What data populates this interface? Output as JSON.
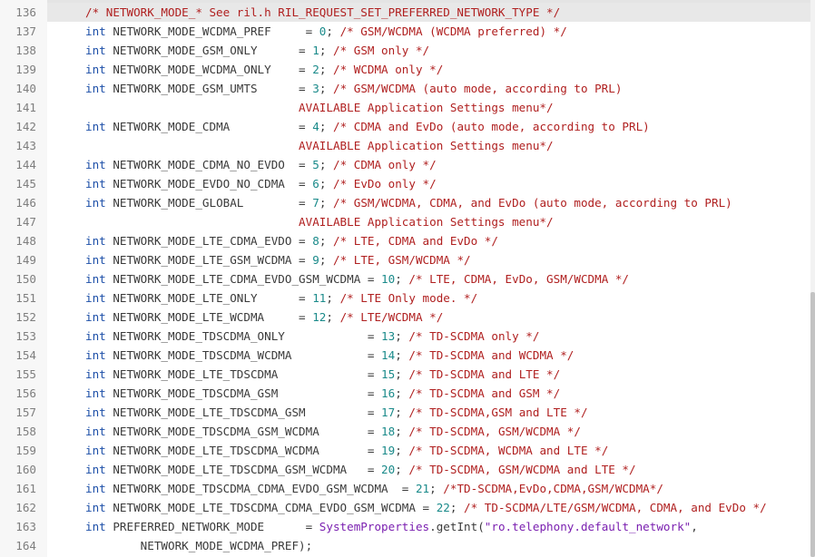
{
  "editor": {
    "lines": [
      {
        "n": "136",
        "current": true,
        "tokens": [
          {
            "t": "/* NETWORK_MODE_* See ril.h RIL_REQUEST_SET_PREFERRED_NETWORK_TYPE */",
            "c": "cm"
          }
        ]
      },
      {
        "n": "137",
        "tokens": [
          {
            "t": "int",
            "c": "kw"
          },
          {
            "t": " NETWORK_MODE_WCDMA_PREF     = ",
            "c": "plain"
          },
          {
            "t": "0",
            "c": "num"
          },
          {
            "t": "; ",
            "c": "plain"
          },
          {
            "t": "/* GSM/WCDMA (WCDMA preferred) */",
            "c": "cm"
          }
        ]
      },
      {
        "n": "138",
        "tokens": [
          {
            "t": "int",
            "c": "kw"
          },
          {
            "t": " NETWORK_MODE_GSM_ONLY      = ",
            "c": "plain"
          },
          {
            "t": "1",
            "c": "num"
          },
          {
            "t": "; ",
            "c": "plain"
          },
          {
            "t": "/* GSM only */",
            "c": "cm"
          }
        ]
      },
      {
        "n": "139",
        "tokens": [
          {
            "t": "int",
            "c": "kw"
          },
          {
            "t": " NETWORK_MODE_WCDMA_ONLY    = ",
            "c": "plain"
          },
          {
            "t": "2",
            "c": "num"
          },
          {
            "t": "; ",
            "c": "plain"
          },
          {
            "t": "/* WCDMA only */",
            "c": "cm"
          }
        ]
      },
      {
        "n": "140",
        "tokens": [
          {
            "t": "int",
            "c": "kw"
          },
          {
            "t": " NETWORK_MODE_GSM_UMTS      = ",
            "c": "plain"
          },
          {
            "t": "3",
            "c": "num"
          },
          {
            "t": "; ",
            "c": "plain"
          },
          {
            "t": "/* GSM/WCDMA (auto mode, according to PRL)",
            "c": "cm"
          }
        ]
      },
      {
        "n": "141",
        "tokens": [
          {
            "t": "                               ",
            "c": "plain"
          },
          {
            "t": "AVAILABLE Application Settings menu*/",
            "c": "cm"
          }
        ]
      },
      {
        "n": "142",
        "tokens": [
          {
            "t": "int",
            "c": "kw"
          },
          {
            "t": " NETWORK_MODE_CDMA          = ",
            "c": "plain"
          },
          {
            "t": "4",
            "c": "num"
          },
          {
            "t": "; ",
            "c": "plain"
          },
          {
            "t": "/* CDMA and EvDo (auto mode, according to PRL)",
            "c": "cm"
          }
        ]
      },
      {
        "n": "143",
        "tokens": [
          {
            "t": "                               ",
            "c": "plain"
          },
          {
            "t": "AVAILABLE Application Settings menu*/",
            "c": "cm"
          }
        ]
      },
      {
        "n": "144",
        "tokens": [
          {
            "t": "int",
            "c": "kw"
          },
          {
            "t": " NETWORK_MODE_CDMA_NO_EVDO  = ",
            "c": "plain"
          },
          {
            "t": "5",
            "c": "num"
          },
          {
            "t": "; ",
            "c": "plain"
          },
          {
            "t": "/* CDMA only */",
            "c": "cm"
          }
        ]
      },
      {
        "n": "145",
        "tokens": [
          {
            "t": "int",
            "c": "kw"
          },
          {
            "t": " NETWORK_MODE_EVDO_NO_CDMA  = ",
            "c": "plain"
          },
          {
            "t": "6",
            "c": "num"
          },
          {
            "t": "; ",
            "c": "plain"
          },
          {
            "t": "/* EvDo only */",
            "c": "cm"
          }
        ]
      },
      {
        "n": "146",
        "tokens": [
          {
            "t": "int",
            "c": "kw"
          },
          {
            "t": " NETWORK_MODE_GLOBAL        = ",
            "c": "plain"
          },
          {
            "t": "7",
            "c": "num"
          },
          {
            "t": "; ",
            "c": "plain"
          },
          {
            "t": "/* GSM/WCDMA, CDMA, and EvDo (auto mode, according to PRL)",
            "c": "cm"
          }
        ]
      },
      {
        "n": "147",
        "tokens": [
          {
            "t": "                               ",
            "c": "plain"
          },
          {
            "t": "AVAILABLE Application Settings menu*/",
            "c": "cm"
          }
        ]
      },
      {
        "n": "148",
        "tokens": [
          {
            "t": "int",
            "c": "kw"
          },
          {
            "t": " NETWORK_MODE_LTE_CDMA_EVDO = ",
            "c": "plain"
          },
          {
            "t": "8",
            "c": "num"
          },
          {
            "t": "; ",
            "c": "plain"
          },
          {
            "t": "/* LTE, CDMA and EvDo */",
            "c": "cm"
          }
        ]
      },
      {
        "n": "149",
        "tokens": [
          {
            "t": "int",
            "c": "kw"
          },
          {
            "t": " NETWORK_MODE_LTE_GSM_WCDMA = ",
            "c": "plain"
          },
          {
            "t": "9",
            "c": "num"
          },
          {
            "t": "; ",
            "c": "plain"
          },
          {
            "t": "/* LTE, GSM/WCDMA */",
            "c": "cm"
          }
        ]
      },
      {
        "n": "150",
        "tokens": [
          {
            "t": "int",
            "c": "kw"
          },
          {
            "t": " NETWORK_MODE_LTE_CDMA_EVDO_GSM_WCDMA = ",
            "c": "plain"
          },
          {
            "t": "10",
            "c": "num"
          },
          {
            "t": "; ",
            "c": "plain"
          },
          {
            "t": "/* LTE, CDMA, EvDo, GSM/WCDMA */",
            "c": "cm"
          }
        ]
      },
      {
        "n": "151",
        "tokens": [
          {
            "t": "int",
            "c": "kw"
          },
          {
            "t": " NETWORK_MODE_LTE_ONLY      = ",
            "c": "plain"
          },
          {
            "t": "11",
            "c": "num"
          },
          {
            "t": "; ",
            "c": "plain"
          },
          {
            "t": "/* LTE Only mode. */",
            "c": "cm"
          }
        ]
      },
      {
        "n": "152",
        "tokens": [
          {
            "t": "int",
            "c": "kw"
          },
          {
            "t": " NETWORK_MODE_LTE_WCDMA     = ",
            "c": "plain"
          },
          {
            "t": "12",
            "c": "num"
          },
          {
            "t": "; ",
            "c": "plain"
          },
          {
            "t": "/* LTE/WCDMA */",
            "c": "cm"
          }
        ]
      },
      {
        "n": "153",
        "tokens": [
          {
            "t": "int",
            "c": "kw"
          },
          {
            "t": " NETWORK_MODE_TDSCDMA_ONLY            = ",
            "c": "plain"
          },
          {
            "t": "13",
            "c": "num"
          },
          {
            "t": "; ",
            "c": "plain"
          },
          {
            "t": "/* TD-SCDMA only */",
            "c": "cm"
          }
        ]
      },
      {
        "n": "154",
        "tokens": [
          {
            "t": "int",
            "c": "kw"
          },
          {
            "t": " NETWORK_MODE_TDSCDMA_WCDMA           = ",
            "c": "plain"
          },
          {
            "t": "14",
            "c": "num"
          },
          {
            "t": "; ",
            "c": "plain"
          },
          {
            "t": "/* TD-SCDMA and WCDMA */",
            "c": "cm"
          }
        ]
      },
      {
        "n": "155",
        "tokens": [
          {
            "t": "int",
            "c": "kw"
          },
          {
            "t": " NETWORK_MODE_LTE_TDSCDMA             = ",
            "c": "plain"
          },
          {
            "t": "15",
            "c": "num"
          },
          {
            "t": "; ",
            "c": "plain"
          },
          {
            "t": "/* TD-SCDMA and LTE */",
            "c": "cm"
          }
        ]
      },
      {
        "n": "156",
        "tokens": [
          {
            "t": "int",
            "c": "kw"
          },
          {
            "t": " NETWORK_MODE_TDSCDMA_GSM             = ",
            "c": "plain"
          },
          {
            "t": "16",
            "c": "num"
          },
          {
            "t": "; ",
            "c": "plain"
          },
          {
            "t": "/* TD-SCDMA and GSM */",
            "c": "cm"
          }
        ]
      },
      {
        "n": "157",
        "tokens": [
          {
            "t": "int",
            "c": "kw"
          },
          {
            "t": " NETWORK_MODE_LTE_TDSCDMA_GSM         = ",
            "c": "plain"
          },
          {
            "t": "17",
            "c": "num"
          },
          {
            "t": "; ",
            "c": "plain"
          },
          {
            "t": "/* TD-SCDMA,GSM and LTE */",
            "c": "cm"
          }
        ]
      },
      {
        "n": "158",
        "tokens": [
          {
            "t": "int",
            "c": "kw"
          },
          {
            "t": " NETWORK_MODE_TDSCDMA_GSM_WCDMA       = ",
            "c": "plain"
          },
          {
            "t": "18",
            "c": "num"
          },
          {
            "t": "; ",
            "c": "plain"
          },
          {
            "t": "/* TD-SCDMA, GSM/WCDMA */",
            "c": "cm"
          }
        ]
      },
      {
        "n": "159",
        "tokens": [
          {
            "t": "int",
            "c": "kw"
          },
          {
            "t": " NETWORK_MODE_LTE_TDSCDMA_WCDMA       = ",
            "c": "plain"
          },
          {
            "t": "19",
            "c": "num"
          },
          {
            "t": "; ",
            "c": "plain"
          },
          {
            "t": "/* TD-SCDMA, WCDMA and LTE */",
            "c": "cm"
          }
        ]
      },
      {
        "n": "160",
        "tokens": [
          {
            "t": "int",
            "c": "kw"
          },
          {
            "t": " NETWORK_MODE_LTE_TDSCDMA_GSM_WCDMA   = ",
            "c": "plain"
          },
          {
            "t": "20",
            "c": "num"
          },
          {
            "t": "; ",
            "c": "plain"
          },
          {
            "t": "/* TD-SCDMA, GSM/WCDMA and LTE */",
            "c": "cm"
          }
        ]
      },
      {
        "n": "161",
        "tokens": [
          {
            "t": "int",
            "c": "kw"
          },
          {
            "t": " NETWORK_MODE_TDSCDMA_CDMA_EVDO_GSM_WCDMA  = ",
            "c": "plain"
          },
          {
            "t": "21",
            "c": "num"
          },
          {
            "t": "; ",
            "c": "plain"
          },
          {
            "t": "/*TD-SCDMA,EvDo,CDMA,GSM/WCDMA*/",
            "c": "cm"
          }
        ]
      },
      {
        "n": "162",
        "tokens": [
          {
            "t": "int",
            "c": "kw"
          },
          {
            "t": " NETWORK_MODE_LTE_TDSCDMA_CDMA_EVDO_GSM_WCDMA = ",
            "c": "plain"
          },
          {
            "t": "22",
            "c": "num"
          },
          {
            "t": "; ",
            "c": "plain"
          },
          {
            "t": "/* TD-SCDMA/LTE/GSM/WCDMA, CDMA, and EvDo */",
            "c": "cm"
          }
        ]
      },
      {
        "n": "163",
        "tokens": [
          {
            "t": "int",
            "c": "kw"
          },
          {
            "t": " PREFERRED_NETWORK_MODE      = ",
            "c": "plain"
          },
          {
            "t": "SystemProperties",
            "c": "cls"
          },
          {
            "t": ".getInt(",
            "c": "plain"
          },
          {
            "t": "\"ro.telephony.default_network\"",
            "c": "str"
          },
          {
            "t": ",",
            "c": "plain"
          }
        ]
      },
      {
        "n": "164",
        "tokens": [
          {
            "t": "        NETWORK_MODE_WCDMA_PREF);",
            "c": "plain"
          }
        ]
      }
    ]
  },
  "colors": {
    "keyword": "#1d4fa8",
    "number": "#1a8a8a",
    "comment": "#b02020",
    "class": "#7a1fb0",
    "string": "#7a1fb0",
    "plain": "#3a3a3a",
    "line_number": "#7e7e7e",
    "current_line_bg": "#e8e8e8"
  }
}
